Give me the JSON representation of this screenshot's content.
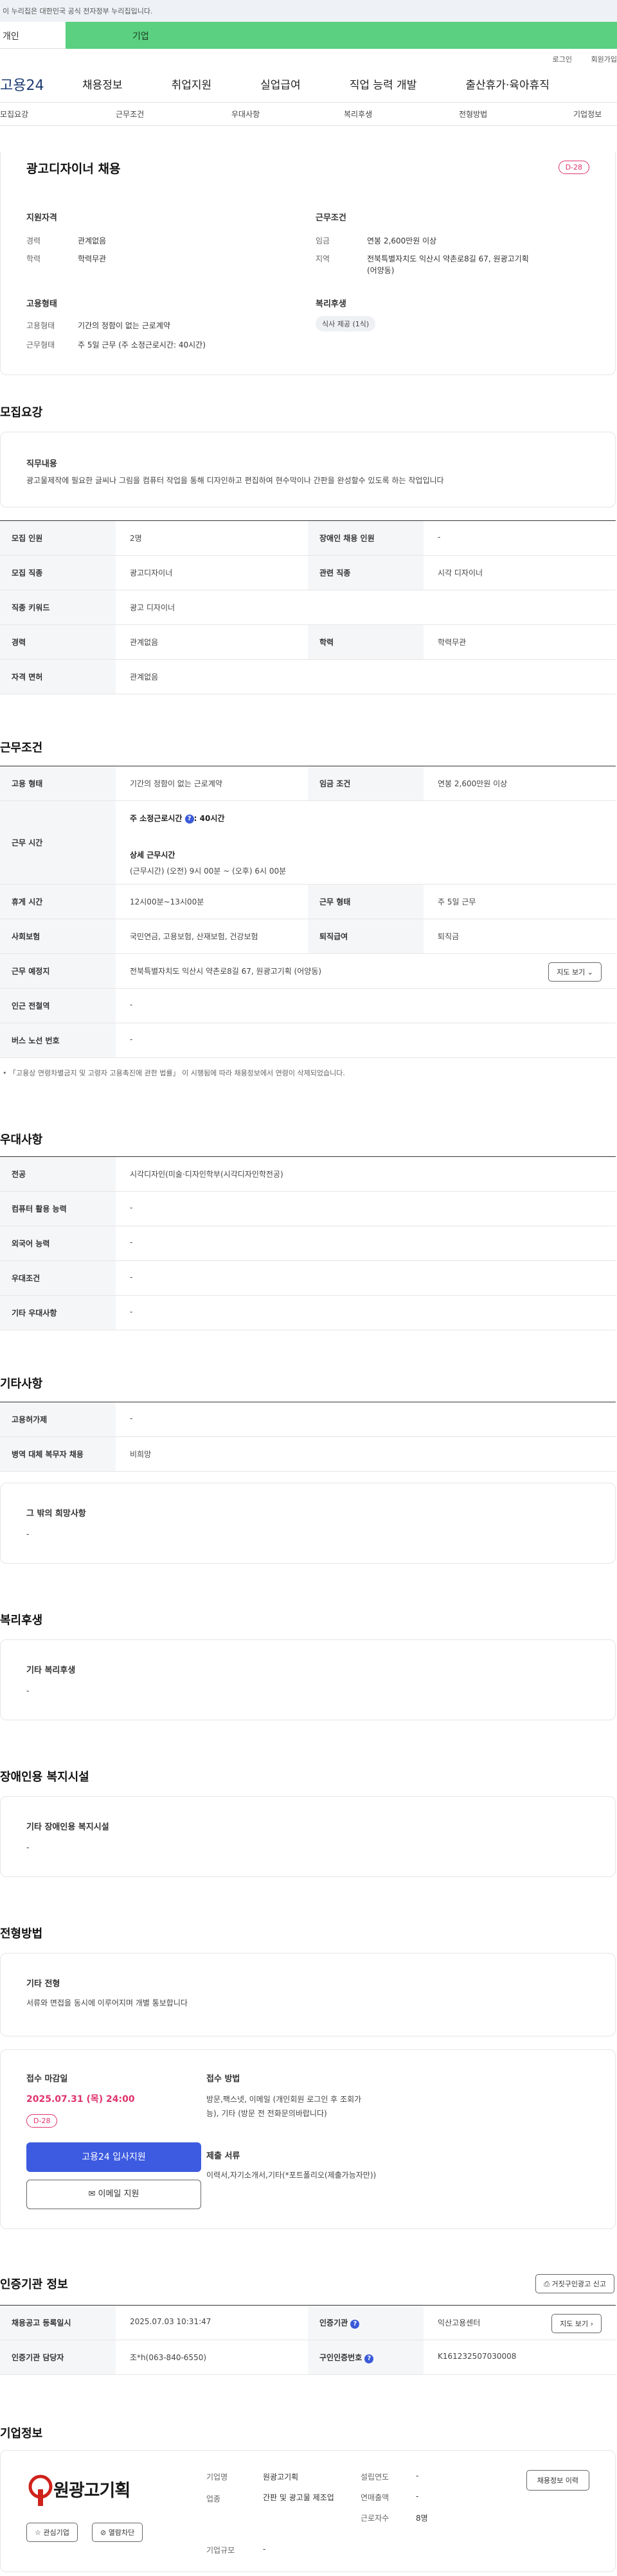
{
  "gov_banner": "이 누리집은 대한민국 공식 전자정부 누리집입니다.",
  "top_tabs": {
    "personal": "개인",
    "company": "기업"
  },
  "util": {
    "login": "로그인",
    "join": "회원가입"
  },
  "gnb": {
    "logo": "고용24",
    "items": [
      "채용정보",
      "취업지원",
      "실업급여",
      "직업 능력 개발",
      "출산휴가·육아휴직"
    ]
  },
  "snb": [
    "모집요강",
    "근무조건",
    "우대사항",
    "복리후생",
    "전형방법",
    "기업정보"
  ],
  "job": {
    "title": "광고디자이너 채용",
    "dday": "D-28",
    "qual_title": "지원자격",
    "qual": [
      {
        "k": "경력",
        "v": "관계없음"
      },
      {
        "k": "학력",
        "v": "학력무관"
      }
    ],
    "cond_title": "근무조건",
    "cond": [
      {
        "k": "임금",
        "v": "연봉 2,600만원 이상"
      },
      {
        "k": "지역",
        "v": "전북특별자치도 익산시 약촌로8길 67, 원광고기획 (어양동)"
      }
    ],
    "emp_title": "고용형태",
    "emp": [
      {
        "k": "고용형태",
        "v": "기간의 정함이 없는 근로계약"
      },
      {
        "k": "근무형태",
        "v": "주 5일 근무 (주 소정근로시간: 40시간)"
      }
    ],
    "welfare_title": "복리후생",
    "welfare_chip": "식사 제공 (1식)"
  },
  "recruit": {
    "title": "모집요강",
    "duty_label": "직무내용",
    "duty_text": "광고물제작에 필요한 글씨나 그림을 컴퓨터 작업을 통해 디자인하고 편집하여 현수막이나 간판을 완성할수 있도록 하는 작업입니다",
    "rows": [
      [
        {
          "th": "모집 인원",
          "td": "2명"
        },
        {
          "th": "장애인 채용 인원",
          "td": "-"
        }
      ],
      [
        {
          "th": "모집 직종",
          "td": "광고디자이너"
        },
        {
          "th": "관련 직종",
          "td": "시각 디자이너"
        }
      ],
      [
        {
          "th": "직종 키워드",
          "td": "광고 디자이너"
        }
      ],
      [
        {
          "th": "경력",
          "td": "관계없음"
        },
        {
          "th": "학력",
          "td": "학력무관"
        }
      ],
      [
        {
          "th": "자격 면허",
          "td": "관계없음"
        }
      ]
    ]
  },
  "work": {
    "title": "근무조건",
    "emp_type_th": "고용 형태",
    "emp_type_td": "기간의 정함이 없는 근로계약",
    "wage_th": "임금 조건",
    "wage_td": "연봉 2,600만원 이상",
    "hours_th": "근무 시간",
    "hours_weekly": "주 소정근로시간",
    "hours_weekly_val": ": 40시간",
    "hours_detail_label": "상세 근무시간",
    "hours_detail": "(근무시간) (오전) 9시 00분 ~ (오후) 6시 00분",
    "rest_th": "휴게 시간",
    "rest_td": "12시00분~13시00분",
    "shift_th": "근무 형태",
    "shift_td": "주 5일 근무",
    "ins_th": "사회보험",
    "ins_td": "국민연금, 고용보험, 산재보험, 건강보험",
    "sev_th": "퇴직급여",
    "sev_td": "퇴직금",
    "place_th": "근무 예정지",
    "place_td": "전북특별자치도 익산시 약촌로8길 67, 원광고기획 (어양동)",
    "map_btn": "지도 보기",
    "station_th": "인근 전철역",
    "station_td": "-",
    "bus_th": "버스 노선 번호",
    "bus_td": "-",
    "note": "「고용상 연령차별금지 및 고령자 고용촉진에 관한 법률」 이 시행됨에 따라 채용정보에서 연령이 삭제되었습니다."
  },
  "pref": {
    "title": "우대사항",
    "rows": [
      {
        "th": "전공",
        "td": "시각디자인(미술·디자인학부(시각디자인학전공)"
      },
      {
        "th": "컴퓨터 활용 능력",
        "td": "-"
      },
      {
        "th": "외국어 능력",
        "td": "-"
      },
      {
        "th": "우대조건",
        "td": "-"
      },
      {
        "th": "기타 우대사항",
        "td": "-"
      }
    ]
  },
  "etc": {
    "title": "기타사항",
    "rows": [
      {
        "th": "고용허가제",
        "td": "-"
      },
      {
        "th": "병역 대체 복무자 채용",
        "td": "비희망"
      }
    ],
    "other_label": "그 밖의 희망사항",
    "other_text": "-"
  },
  "welfare": {
    "title": "복리후생",
    "label": "기타 복리후생",
    "text": "-"
  },
  "disability": {
    "title": "장애인용 복지시설",
    "label": "기타 장애인용 복지시설",
    "text": "-"
  },
  "process": {
    "title": "전형방법",
    "label": "기타 전형",
    "text": "서류와 면접을 동시에 이루어지며 개별 통보합니다",
    "deadline_label": "접수 마감일",
    "deadline": "2025.07.31 (목) 24:00",
    "dday": "D-28",
    "apply_btn": "고용24 입사지원",
    "email_btn": "이메일 지원",
    "method_label": "접수 방법",
    "method_text": "방문,팩스넷, 이메일 (개인회원 로그인 후 조회가능), 기타 (방문 전 전화문의바랍니다)",
    "docs_label": "제출 서류",
    "docs_text": "이력서,자기소개서,기타(*포트폴리오(제출가능자만))"
  },
  "agency": {
    "title": "인증기관 정보",
    "report_btn": "거짓구인광고 신고",
    "reg_th": "채용공고 등록일시",
    "reg_td": "2025.07.03 10:31:47",
    "org_th": "인증기관",
    "org_td": "익산고용센터",
    "map_btn": "지도 보기",
    "mgr_th": "인증기관 담당자",
    "mgr_td": "조*h(063-840-6550)",
    "no_th": "구인인증번호",
    "no_td": "K161232507030008"
  },
  "company": {
    "title": "기업정보",
    "logo_text": "원광고기획",
    "interest_btn": "관심기업",
    "block_btn": "열람차단",
    "fields": [
      {
        "k": "기업명",
        "v": "원광고기획"
      },
      {
        "k": "업종",
        "v": "간판 및 광고물 제조업"
      },
      {
        "k": "기업규모",
        "v": "-"
      }
    ],
    "fields2": [
      {
        "k": "설립연도",
        "v": "-"
      },
      {
        "k": "연매출액",
        "v": "-"
      },
      {
        "k": "근로자수",
        "v": "8명"
      }
    ],
    "recruit_btn": "채용정보 이력"
  }
}
